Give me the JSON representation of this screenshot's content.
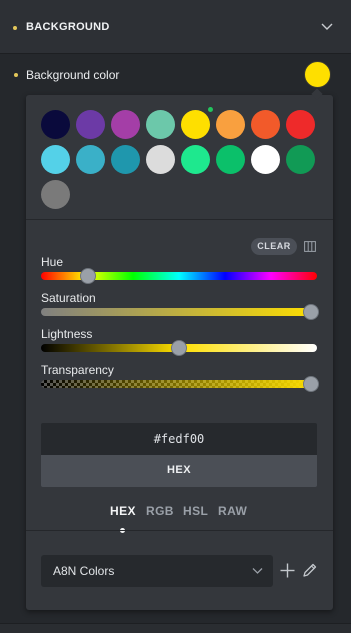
{
  "section": {
    "title": "BACKGROUND"
  },
  "field": {
    "label": "Background color",
    "current_color": "#fedf00"
  },
  "presets": [
    {
      "color": "#0a0a3c"
    },
    {
      "color": "#6c3aa6"
    },
    {
      "color": "#a43ea7"
    },
    {
      "color": "#6cc8aa"
    },
    {
      "color": "#fedf00",
      "selected": true
    },
    {
      "color": "#f9a03f"
    },
    {
      "color": "#f25a2a"
    },
    {
      "color": "#ee2a2a"
    },
    {
      "color": "#54d1e8"
    },
    {
      "color": "#3ab0c8"
    },
    {
      "color": "#1f97ad"
    },
    {
      "color": "#dcdcdc"
    },
    {
      "color": "#1ee88e"
    },
    {
      "color": "#0bc06a"
    },
    {
      "color": "#ffffff"
    },
    {
      "color": "#119a55"
    },
    {
      "color": "#7a7a7a"
    }
  ],
  "picker": {
    "clear_label": "CLEAR",
    "sliders": {
      "hue": {
        "label": "Hue",
        "value": 0.17
      },
      "saturation": {
        "label": "Saturation",
        "value": 1.0
      },
      "lightness": {
        "label": "Lightness",
        "value": 0.5
      },
      "transparency": {
        "label": "Transparency",
        "value": 1.0
      }
    },
    "hex_value": "#fedf00",
    "format_label": "HEX",
    "tabs": [
      {
        "label": "HEX",
        "active": true
      },
      {
        "label": "RGB"
      },
      {
        "label": "HSL"
      },
      {
        "label": "RAW"
      }
    ],
    "palette_select": {
      "value": "A8N Colors"
    }
  },
  "icons": {
    "chevron": "chevron-down-icon",
    "columns": "columns-icon",
    "plus": "plus-icon",
    "pencil": "pencil-icon"
  }
}
